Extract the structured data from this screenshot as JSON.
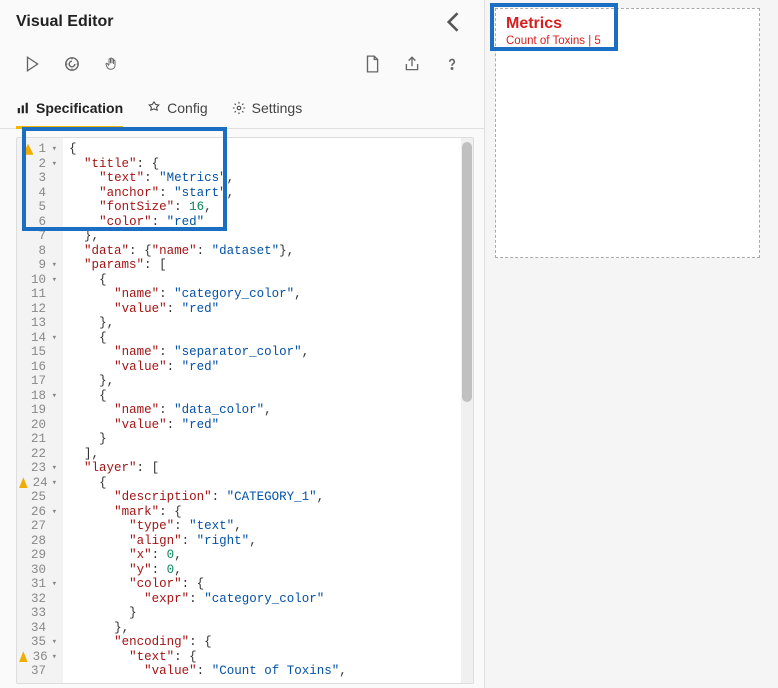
{
  "header": {
    "title": "Visual Editor"
  },
  "tabs": {
    "spec": "Specification",
    "config": "Config",
    "settings": "Settings"
  },
  "preview": {
    "title": "Metrics",
    "subtitle": "Count of Toxins | 5"
  },
  "code_lines": [
    "{",
    "  \"title\": {",
    "    \"text\": \"Metrics\",",
    "    \"anchor\": \"start\",",
    "    \"fontSize\": 16,",
    "    \"color\": \"red\"",
    "  },",
    "  \"data\": {\"name\": \"dataset\"},",
    "  \"params\": [",
    "    {",
    "      \"name\": \"category_color\",",
    "      \"value\": \"red\"",
    "    },",
    "    {",
    "      \"name\": \"separator_color\",",
    "      \"value\": \"red\"",
    "    },",
    "    {",
    "      \"name\": \"data_color\",",
    "      \"value\": \"red\"",
    "    }",
    "  ],",
    "  \"layer\": [",
    "    {",
    "      \"description\": \"CATEGORY_1\",",
    "      \"mark\": {",
    "        \"type\": \"text\",",
    "        \"align\": \"right\",",
    "        \"x\": 0,",
    "        \"y\": 0,",
    "        \"color\": {",
    "          \"expr\": \"category_color\"",
    "        }",
    "      },",
    "      \"encoding\": {",
    "        \"text\": {",
    "          \"value\": \"Count of Toxins\","
  ],
  "gutter": {
    "fold_rows": [
      1,
      2,
      9,
      10,
      14,
      18,
      23,
      24,
      26,
      31,
      35,
      36
    ],
    "warn_rows": [
      1,
      24,
      36
    ]
  }
}
